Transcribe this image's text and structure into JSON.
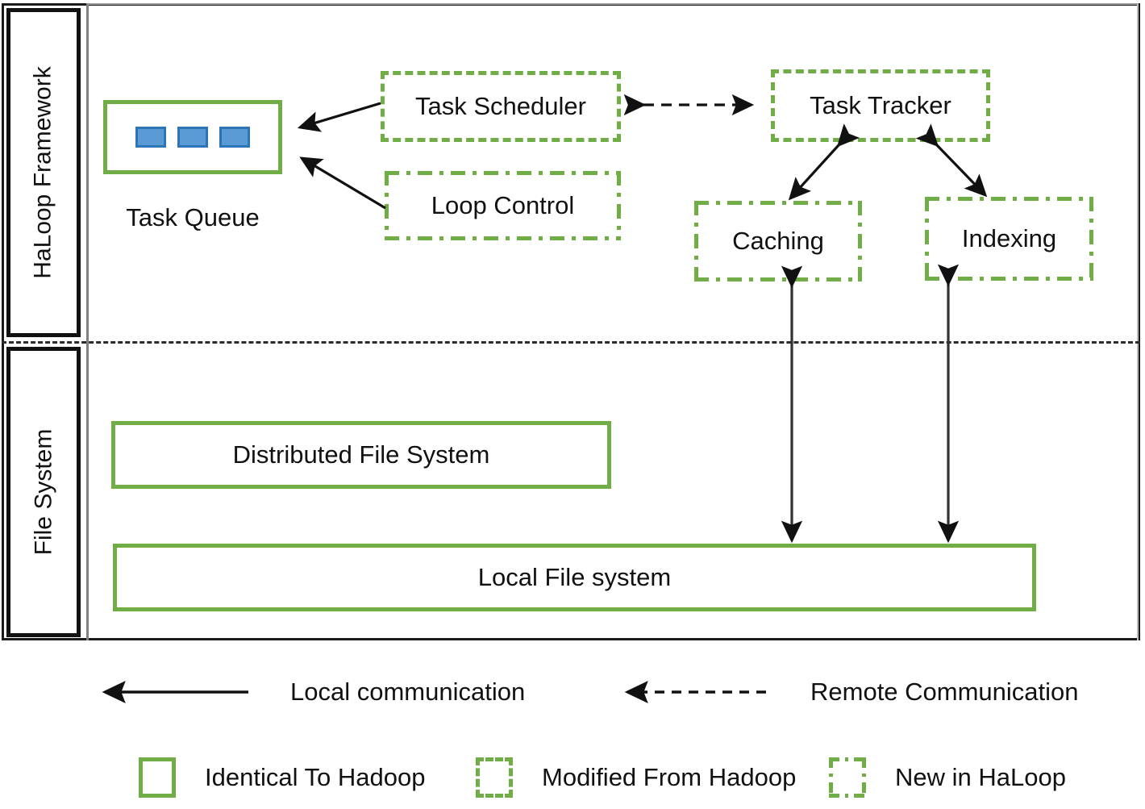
{
  "diagram": {
    "layers": [
      {
        "id": "haloop",
        "label": "HaLoop Framework"
      },
      {
        "id": "filesystem",
        "label": "File System"
      }
    ],
    "nodes": {
      "task_queue": {
        "label": "Task Queue",
        "style": "solid",
        "slots": 3,
        "slot_color": "#5B9BD5",
        "slot_border": "#2E75B6"
      },
      "task_scheduler": {
        "label": "Task Scheduler",
        "style": "dashed"
      },
      "loop_control": {
        "label": "Loop Control",
        "style": "dashdot"
      },
      "task_tracker": {
        "label": "Task Tracker",
        "style": "dashed"
      },
      "caching": {
        "label": "Caching",
        "style": "dashdot"
      },
      "indexing": {
        "label": "Indexing",
        "style": "dashdot"
      },
      "distributed_file_system": {
        "label": "Distributed File System",
        "style": "solid"
      },
      "local_file_system": {
        "label": "Local File system",
        "style": "solid"
      }
    },
    "edges": [
      {
        "from": "task_scheduler",
        "to": "task_queue",
        "kind": "local",
        "arrows": "single"
      },
      {
        "from": "loop_control",
        "to": "task_queue",
        "kind": "local",
        "arrows": "single"
      },
      {
        "from": "task_scheduler",
        "to": "task_tracker",
        "kind": "remote",
        "arrows": "double"
      },
      {
        "from": "task_tracker",
        "to": "caching",
        "kind": "local",
        "arrows": "double"
      },
      {
        "from": "task_tracker",
        "to": "indexing",
        "kind": "local",
        "arrows": "double"
      },
      {
        "from": "caching",
        "to": "local_file_system",
        "kind": "local",
        "arrows": "double"
      },
      {
        "from": "indexing",
        "to": "local_file_system",
        "kind": "local",
        "arrows": "double"
      }
    ],
    "colors": {
      "green": "#70AD47",
      "blue_fill": "#5B9BD5",
      "blue_border": "#2E75B6",
      "black": "#111111",
      "frame_gray": "#808080"
    }
  },
  "legend": {
    "communication": [
      {
        "id": "local",
        "label": "Local communication",
        "line": "solid"
      },
      {
        "id": "remote",
        "label": "Remote Communication",
        "line": "dashed"
      }
    ],
    "box_styles": [
      {
        "id": "identical",
        "label": "Identical To Hadoop",
        "style": "solid"
      },
      {
        "id": "modified",
        "label": "Modified From Hadoop",
        "style": "dashed"
      },
      {
        "id": "new",
        "label": "New in HaLoop",
        "style": "dashdot"
      }
    ]
  }
}
